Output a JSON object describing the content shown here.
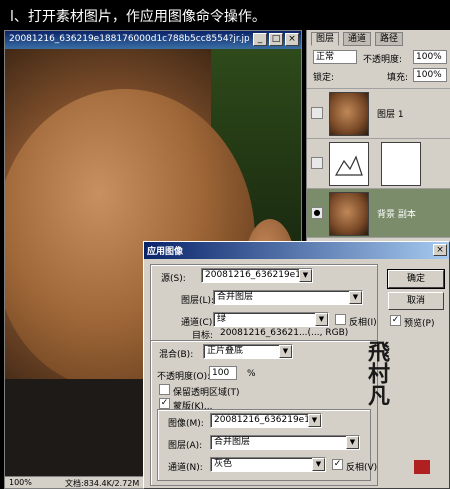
{
  "caption": {
    "text": "l、打开素材图片，作应用图像命令操作。"
  },
  "document": {
    "title": "20081216_636219e188176000d1c788b5cc8554?jr.jp...",
    "status": {
      "zoom": "100%",
      "doc_size": "文档:834.4K/2.72M"
    }
  },
  "layers_panel": {
    "tabs": [
      "图层",
      "通道",
      "路径"
    ],
    "blend_mode": "正常",
    "opacity_label": "不透明度:",
    "opacity_value": "100%",
    "lock_label": "锁定:",
    "fill_label": "填充:",
    "fill_value": "100%",
    "layers": [
      {
        "name": "图层 1",
        "active": false
      },
      {
        "name": "",
        "active": false
      },
      {
        "name": "背景 副本",
        "active": true
      }
    ]
  },
  "dialog": {
    "title": "应用图像",
    "source_label": "源(S):",
    "source_value": "20081216_636219e188...",
    "layer_label": "图层(L):",
    "layer_value": "合并图层",
    "channel_label": "通道(C):",
    "channel_value": "绿",
    "invert_label": "反相(I)",
    "target_label": "目标:",
    "target_value": "20081216_63621...(..., RGB)",
    "blending_label": "混合(B):",
    "blending_value": "正片叠底",
    "opacity_label": "不透明度(O):",
    "opacity_value": "100",
    "opacity_unit": "%",
    "preserve_label": "保留透明区域(T)",
    "mask_label": "蒙版(K)...",
    "image_label": "图像(M):",
    "image_value": "20081216_636219e188...",
    "mask_layer_label": "图层(A):",
    "mask_layer_value": "合并图层",
    "mask_channel_label": "通道(N):",
    "mask_channel_value": "灰色",
    "mask_invert_label": "反相(V)",
    "ok_label": "确定",
    "cancel_label": "取消",
    "preview_label": "预览(P)"
  },
  "watermark": {
    "text": "飛村凡"
  }
}
